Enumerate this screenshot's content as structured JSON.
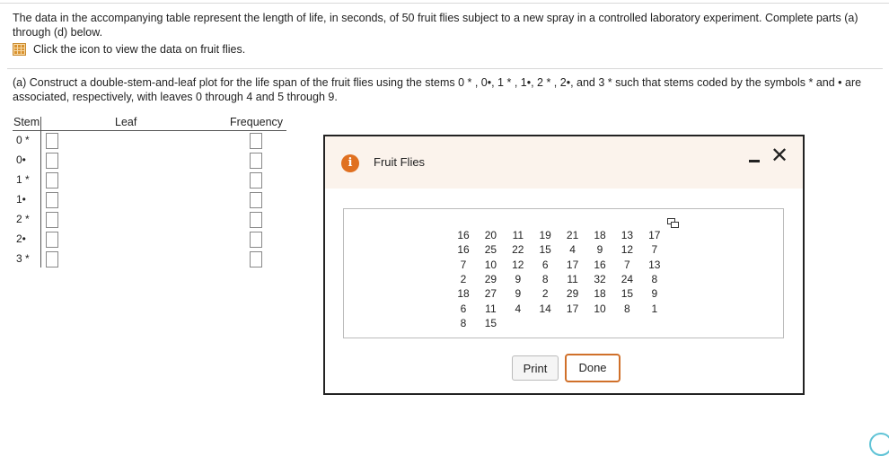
{
  "intro": {
    "text": "The data in the accompanying table represent the length of life, in seconds, of 50 fruit flies subject to a new spray in a controlled laboratory experiment. Complete parts (a) through (d) below.",
    "icon_text": "Click the icon to view the data on fruit flies."
  },
  "part_a": {
    "text": "(a) Construct a double-stem-and-leaf plot for the life span of the fruit flies using the stems 0 * , 0•, 1 * , 1•, 2 * , 2•, and 3 *  such that stems coded by the symbols  *  and • are associated, respectively, with leaves 0 through 4 and 5 through 9."
  },
  "table": {
    "col_stem": "Stem",
    "col_leaf": "Leaf",
    "col_frequency": "Frequency",
    "stems": [
      "0 *",
      "0•",
      "1 *",
      "1•",
      "2 *",
      "2•",
      "3 *"
    ]
  },
  "modal": {
    "title": "Fruit Flies",
    "info_glyph": "i",
    "minimize_glyph": "-",
    "close_glyph": "✕",
    "data_rows": [
      [
        "16",
        "20",
        "11",
        "19",
        "21",
        "18",
        "13",
        "17"
      ],
      [
        "16",
        "25",
        "22",
        "15",
        "4",
        "9",
        "12",
        "7"
      ],
      [
        "7",
        "10",
        "12",
        "6",
        "17",
        "16",
        "7",
        "13"
      ],
      [
        "2",
        "29",
        "9",
        "8",
        "11",
        "32",
        "24",
        "8"
      ],
      [
        "18",
        "27",
        "9",
        "2",
        "29",
        "18",
        "15",
        "9"
      ],
      [
        "6",
        "11",
        "4",
        "14",
        "17",
        "10",
        "8",
        "1"
      ],
      [
        "8",
        "15"
      ]
    ],
    "print_label": "Print",
    "done_label": "Done"
  },
  "colors": {
    "accent": "#d0702a",
    "icon_orange": "#e07020",
    "header_bg": "#fbf3ec"
  }
}
